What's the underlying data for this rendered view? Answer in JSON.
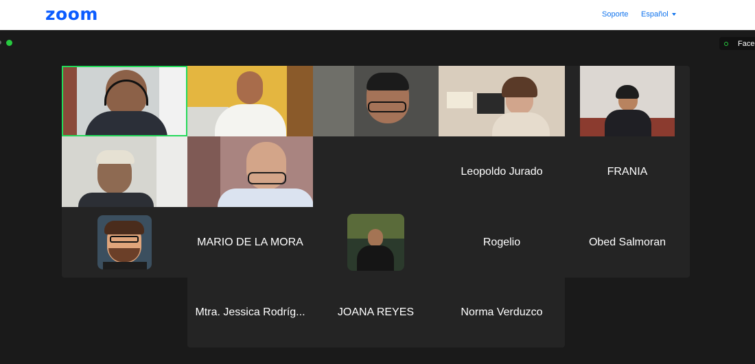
{
  "brand": {
    "logo_text": "zoom",
    "accent": "#0b5cff"
  },
  "header": {
    "support_label": "Soporte",
    "language_label": "Español"
  },
  "share_indicator": {
    "label": "Faceb",
    "icon": "signal-icon"
  },
  "participants": {
    "video": [
      "speaker-glasses-headset",
      "woman-yellow-room",
      "young-man-glasses",
      "woman-kitchen",
      "woman-dark-blazer",
      "man-cap-glasses",
      "man-glasses-office"
    ],
    "names": {
      "leopoldo": "Leopoldo Jurado",
      "frania": "FRANIA",
      "mario": "MARIO DE LA MORA",
      "rogelio": "Rogelio",
      "obed": "Obed Salmoran",
      "jessica": "Mtra. Jessica Rodríg...",
      "joana": "JOANA REYES",
      "norma": "Norma Verduzco"
    }
  },
  "colors": {
    "active_speaker_border": "#23d959",
    "tile_bg": "#242424",
    "page_bg": "#1a1a1a"
  }
}
